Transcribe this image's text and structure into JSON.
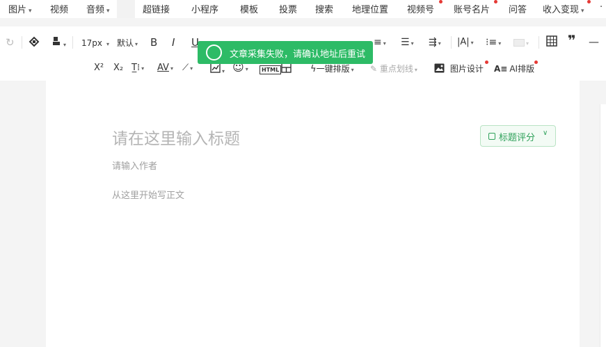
{
  "menu": {
    "items": [
      {
        "label": "图片",
        "caret": "▾"
      },
      {
        "label": "视频"
      },
      {
        "label": "音频",
        "caret": "▾"
      },
      {
        "label": "超链接"
      },
      {
        "label": "小程序"
      },
      {
        "label": "模板"
      },
      {
        "label": "投票"
      },
      {
        "label": "搜索"
      },
      {
        "label": "地理位置"
      },
      {
        "label": "视频号"
      },
      {
        "label": "账号名片"
      },
      {
        "label": "问答"
      },
      {
        "label": "收入变现",
        "caret": "▾"
      },
      {
        "label": "·"
      }
    ]
  },
  "toolbar": {
    "font_size": "17px",
    "font_family": "默认",
    "bold": "B",
    "italic": "I",
    "underline": "U",
    "superscript": "X²",
    "subscript": "X₂",
    "html_label": "HTML",
    "one_click_layout": "一键排版",
    "highlight_line": "重点划线",
    "image_design": "图片设计",
    "ai_layout": "AI排版",
    "quote": "❞",
    "dash": "—"
  },
  "toast": {
    "message": "文章采集失败，请确认地址后重试",
    "color": "#2dbb66"
  },
  "editor": {
    "title_placeholder": "请在这里输入标题",
    "author_placeholder": "请输入作者",
    "body_placeholder": "从这里开始写正文",
    "score_button": "标题评分"
  },
  "colors": {
    "accent_green": "#2fa15a",
    "notice_red": "#e53935"
  }
}
